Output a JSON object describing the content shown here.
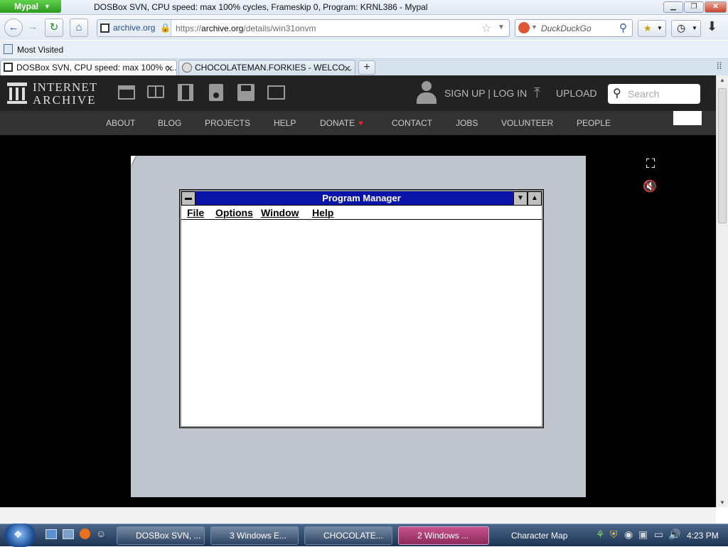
{
  "browser": {
    "app_button": "Mypal",
    "window_title": "DOSBox SVN, CPU speed: max 100% cycles, Frameskip 0, Program: KRNL386 - Mypal",
    "site_identity": "archive.org",
    "url_prefix": "https://",
    "url_host": "archive.org",
    "url_path": "/details/win31onvm",
    "search_placeholder": "DuckDuckGo",
    "bookmark": "Most Visited",
    "tabs": [
      {
        "label": "DOSBox SVN, CPU speed: max 100% c...",
        "active": true
      },
      {
        "label": "CHOCOLATEMAN.FORKIES - WELCO...",
        "active": false
      }
    ]
  },
  "ia": {
    "logo_line1": "INTERNET",
    "logo_line2": "ARCHIVE",
    "signup": "SIGN UP | LOG IN",
    "upload": "UPLOAD",
    "search_placeholder": "Search",
    "menu": [
      "ABOUT",
      "BLOG",
      "PROJECTS",
      "HELP",
      "DONATE",
      "CONTACT",
      "JOBS",
      "VOLUNTEER",
      "PEOPLE"
    ]
  },
  "emulator": {
    "window_title": "Program Manager",
    "menu": [
      "File",
      "Options",
      "Window",
      "Help"
    ]
  },
  "taskbar": {
    "tasks": [
      {
        "label": "DOSBox SVN, ...",
        "active": false
      },
      {
        "label": "3 Windows E...",
        "active": false
      },
      {
        "label": "CHOCOLATE...",
        "active": false
      },
      {
        "label": "2 Windows ...",
        "active": true
      },
      {
        "label": "Character Map",
        "active": false
      }
    ],
    "clock": "4:23 PM"
  },
  "colors": {
    "ia_header": "#222222",
    "ia_menu": "#333333",
    "win31_title": "#0a14a8",
    "donate_heart": "#e0202a"
  }
}
